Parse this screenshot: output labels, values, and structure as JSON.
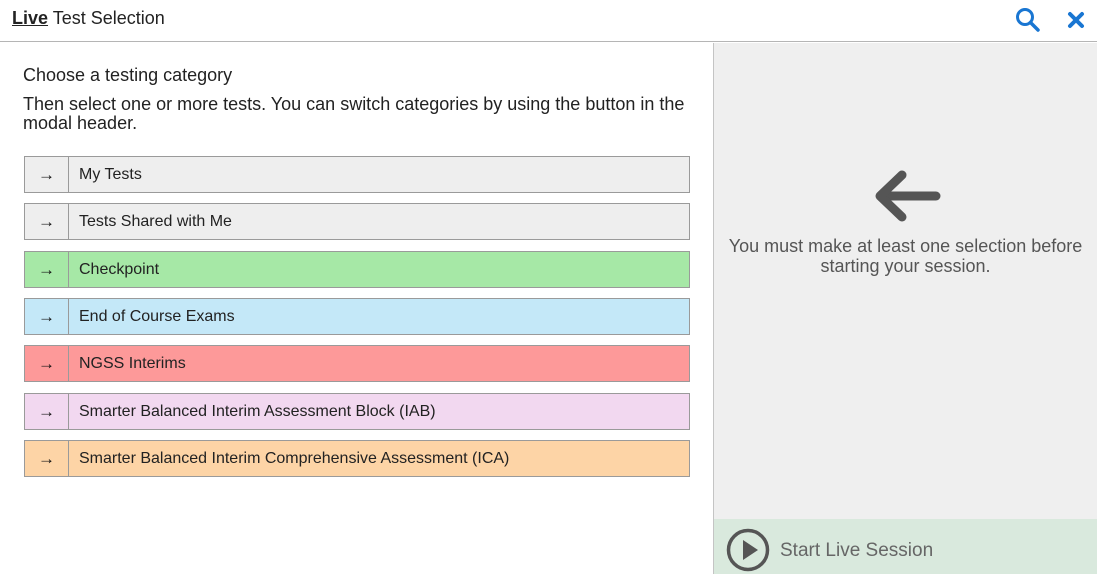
{
  "header": {
    "title_bold": "Live",
    "title_rest": " Test Selection",
    "search_icon": "search-icon",
    "close_icon": "close-icon",
    "accent_color": "#1976d2"
  },
  "left": {
    "heading": "Choose a testing category",
    "instructions": "Then select one or more tests. You can switch categories by using the button in the modal header.",
    "categories": [
      {
        "arrow": "→",
        "label": "My Tests",
        "color": "#eeeeee"
      },
      {
        "arrow": "→",
        "label": "Tests Shared with Me",
        "color": "#eeeeee"
      },
      {
        "arrow": "→",
        "label": "Checkpoint",
        "color": "#a6e8a6"
      },
      {
        "arrow": "→",
        "label": "End of Course Exams",
        "color": "#c4e8f8"
      },
      {
        "arrow": "→",
        "label": "NGSS Interims",
        "color": "#fd9999"
      },
      {
        "arrow": "→",
        "label": "Smarter Balanced Interim Assessment Block (IAB)",
        "color": "#f2d8f0"
      },
      {
        "arrow": "→",
        "label": "Smarter Balanced Interim Comprehensive Assessment (ICA)",
        "color": "#fdd4a6"
      }
    ]
  },
  "right": {
    "arrow_icon": "arrow-left-icon",
    "message_line1": "You must make at least one selection before",
    "message_line2": "starting your session.",
    "start_label": "Start Live Session",
    "play_icon": "play-circle-icon"
  }
}
